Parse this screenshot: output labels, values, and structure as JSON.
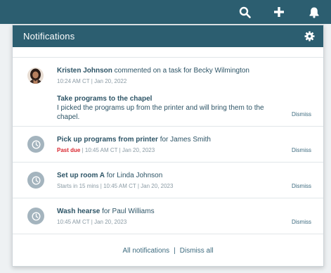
{
  "topbar": {
    "icons": [
      "search-icon",
      "plus-icon",
      "bell-icon"
    ],
    "background": "#2c5e70"
  },
  "panel": {
    "title": "Notifications",
    "settings_icon": "gear-icon"
  },
  "notifications": [
    {
      "actor": "Kristen Johnson",
      "action": " commented on a task for Becky Wilmington",
      "meta": "10:24 AM CT | Jan 20, 2022",
      "task_title": "Take programs to the chapel",
      "task_body": "I picked the programs up from the printer and will bring them to the chapel.",
      "dismiss": "Dismiss"
    },
    {
      "task": "Pick up programs from printer",
      "for_text": " for James Smith",
      "status": "Past due",
      "meta": " | 10:45 AM CT | Jan 20, 2023",
      "dismiss": "Dismiss"
    },
    {
      "task": "Set up room A",
      "for_text": " for Linda Johnson",
      "meta": "Starts in 15 mins | 10:45 AM CT | Jan 20, 2023",
      "dismiss": "Dismiss"
    },
    {
      "task": "Wash hearse",
      "for_text": " for Paul Williams",
      "meta": "10:45 AM CT | Jan 20, 2023",
      "dismiss": "Dismiss"
    }
  ],
  "footer": {
    "all_label": "All notifications",
    "separator": "|",
    "dismiss_all_label": "Dismiss all"
  },
  "colors": {
    "header": "#2c5e70",
    "text": "#2d5466",
    "overdue": "#d9262f",
    "muted": "#8a9aa4"
  }
}
